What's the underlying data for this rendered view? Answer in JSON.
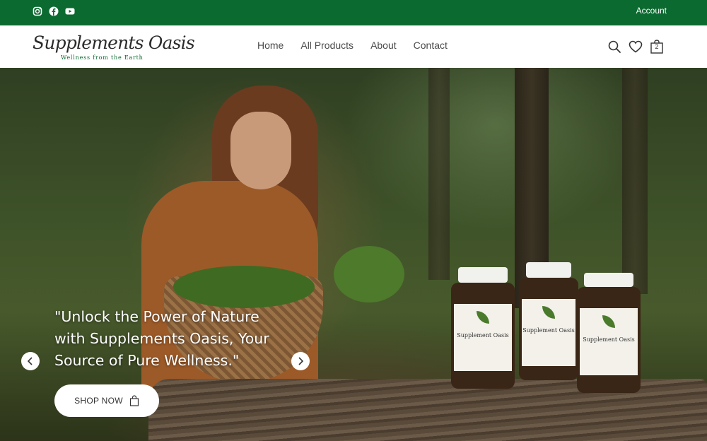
{
  "topbar": {
    "social_icons": [
      "instagram-icon",
      "facebook-icon",
      "youtube-icon"
    ],
    "account_label": "Account",
    "background_color": "#0b6a2f"
  },
  "header": {
    "logo_title": "Supplements Oasis",
    "logo_tagline": "Wellness from the Earth",
    "nav": [
      "Home",
      "All Products",
      "About",
      "Contact"
    ],
    "icons": [
      "search-icon",
      "heart-icon",
      "cart-icon"
    ],
    "cart_count": "2"
  },
  "hero": {
    "headline": "\"Unlock the Power of Nature with Supplements Oasis, Your Source of Pure Wellness.\"",
    "cta_label": "SHOP NOW",
    "prev_icon": "chevron-left-icon",
    "next_icon": "chevron-right-icon",
    "product_label": "Supplement Oasis"
  }
}
